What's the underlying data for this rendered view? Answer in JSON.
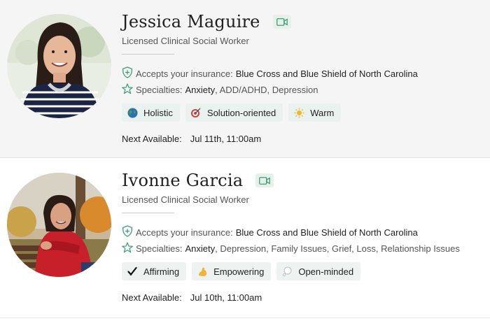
{
  "providers": [
    {
      "name": "Jessica Maguire",
      "title": "Licensed Clinical Social Worker",
      "insurance_label": "Accepts your insurance:",
      "insurance_value": "Blue Cross and Blue Shield of North Carolina",
      "specialties_label": "Specialties:",
      "specialties_first": "Anxiety",
      "specialties_rest": ", ADD/ADHD, Depression",
      "tags": [
        {
          "label": "Holistic",
          "icon": "globe-icon"
        },
        {
          "label": "Solution-oriented",
          "icon": "target-icon"
        },
        {
          "label": "Warm",
          "icon": "sun-icon"
        }
      ],
      "next_label": "Next Available:",
      "next_value": "Jul 11th, 11:00am"
    },
    {
      "name": "Ivonne Garcia",
      "title": "Licensed Clinical Social Worker",
      "insurance_label": "Accepts your insurance:",
      "insurance_value": "Blue Cross and Blue Shield of North Carolina",
      "specialties_label": "Specialties:",
      "specialties_first": "Anxiety",
      "specialties_rest": ", Depression, Family Issues, Grief, Loss, Relationship Issues",
      "tags": [
        {
          "label": "Affirming",
          "icon": "checkmark-icon"
        },
        {
          "label": "Empowering",
          "icon": "flexed-arm-icon"
        },
        {
          "label": "Open-minded",
          "icon": "thought-bubble-icon"
        }
      ],
      "next_label": "Next Available:",
      "next_value": "Jul 10th, 11:00am"
    }
  ],
  "colors": {
    "accent_green": "#3b9e74",
    "tag_bg": "#e9f2ee",
    "card_bg_selected": "#f4f5f4"
  }
}
